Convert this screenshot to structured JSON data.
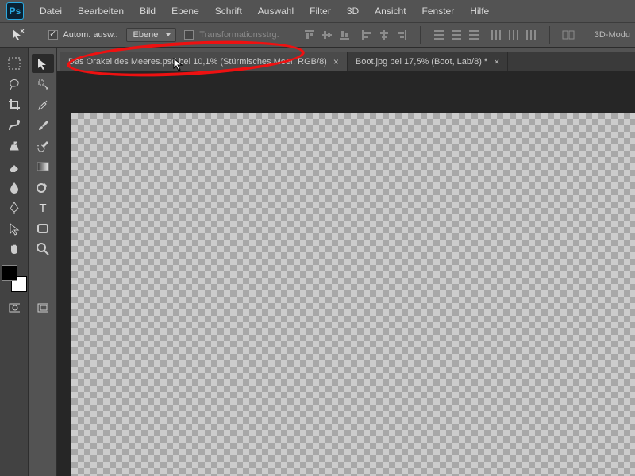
{
  "menubar": {
    "items": [
      "Datei",
      "Bearbeiten",
      "Bild",
      "Ebene",
      "Schrift",
      "Auswahl",
      "Filter",
      "3D",
      "Ansicht",
      "Fenster",
      "Hilfe"
    ]
  },
  "optionsbar": {
    "auto_select_label": "Autom. ausw.:",
    "layer_dropdown": "Ebene",
    "transform_label": "Transformationsstrg.",
    "threed_label": "3D-Modu"
  },
  "tabs": [
    {
      "label": "Das Orakel des Meeres.psd bei 10,1%  (Stürmisches Meer, RGB/8)",
      "active": true
    },
    {
      "label": "Boot.jpg bei 17,5% (Boot, Lab/8) *",
      "active": false
    }
  ],
  "tools_left": [
    "rect-marquee",
    "move",
    "lasso",
    "magic-wand",
    "crop",
    "eyedropper",
    "healing",
    "brush",
    "clone",
    "history-brush",
    "eraser",
    "gradient",
    "blur",
    "dodge",
    "pen",
    "type",
    "path-select",
    "shape",
    "hand",
    "zoom"
  ],
  "swatches": {
    "fg": "#000000",
    "bg": "#ffffff"
  }
}
